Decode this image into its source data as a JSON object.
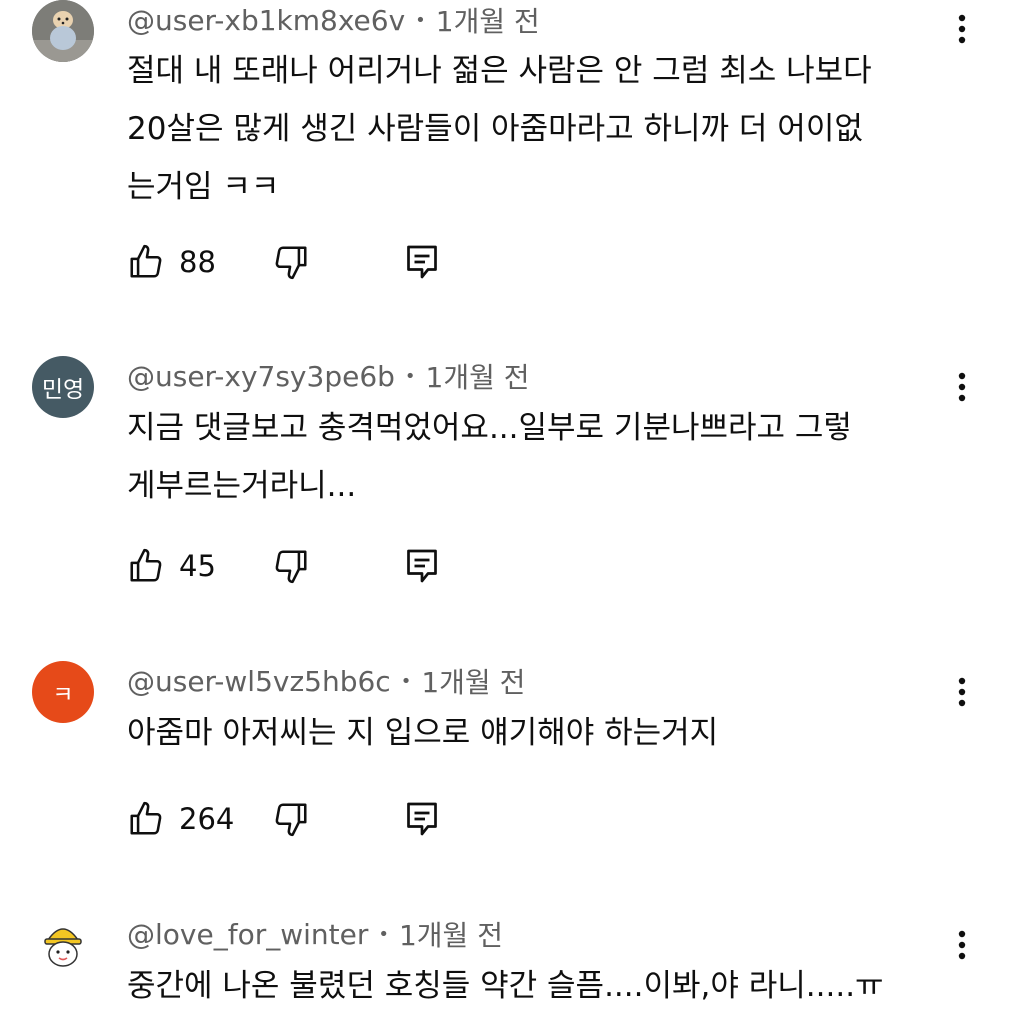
{
  "comments": [
    {
      "author": "@user-xb1km8xe6v",
      "time": "1개월 전",
      "avatar": {
        "type": "photo",
        "color": "#8a8a8a",
        "text": ""
      },
      "lines": [
        "절대 내 또래나 어리거나  젊은 사람은 안 그럼 최소 나보다",
        "20살은 많게 생긴 사람들이 아줌마라고 하니까 더 어이없",
        "는거임 ㅋㅋ"
      ],
      "likes": "88"
    },
    {
      "author": "@user-xy7sy3pe6b",
      "time": "1개월 전",
      "avatar": {
        "type": "text",
        "color": "#455a64",
        "text": "민영"
      },
      "lines": [
        "지금 댓글보고 충격먹었어요...일부로 기분나쁘라고 그렇",
        "게부르는거라니..."
      ],
      "likes": "45"
    },
    {
      "author": "@user-wl5vz5hb6c",
      "time": "1개월 전",
      "avatar": {
        "type": "text",
        "color": "#e64a19",
        "text": "ㅋ"
      },
      "lines": [
        "아줌마 아저씨는 지 입으로 얘기해야 하는거지"
      ],
      "likes": "264"
    },
    {
      "author": "@love_for_winter",
      "time": "1개월 전",
      "avatar": {
        "type": "illustration",
        "color": "#ffffff",
        "text": ""
      },
      "lines": [
        "중간에 나온 불렸던 호칭들 약간 슬픔....이봐,야 라니.....ㅠ"
      ],
      "likes": ""
    }
  ],
  "icons": {
    "like": "thumbs-up-icon",
    "dislike": "thumbs-down-icon",
    "reply": "reply-icon",
    "more": "more-vertical-icon"
  },
  "colors": {
    "text": "#0f0f0f",
    "meta": "#606060"
  }
}
